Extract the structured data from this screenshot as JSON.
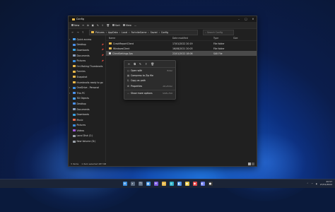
{
  "window": {
    "tab_title": "Config",
    "controls": [
      "–",
      "□",
      "✕"
    ]
  },
  "toolbar": {
    "new_label": "New",
    "sort_label": "Sort",
    "view_label": "View",
    "more_label": "..."
  },
  "address": {
    "path": [
      "Pictures",
      "AppData",
      "Local",
      "FortniteGame",
      "Saved",
      "Config"
    ],
    "search_placeholder": "Search Config"
  },
  "sidebar": {
    "items": [
      {
        "label": "Quick access",
        "icon": "star-icon",
        "color": "#4aa3ff",
        "top": true
      },
      {
        "label": "Desktop",
        "icon": "desktop-icon",
        "color": "#4a8fe8",
        "pinned": true
      },
      {
        "label": "Downloads",
        "icon": "download-icon",
        "color": "#3aa0e0",
        "pinned": true
      },
      {
        "label": "Documents",
        "icon": "documents-icon",
        "color": "#8aa0c0",
        "pinned": true
      },
      {
        "label": "Pictures",
        "icon": "pictures-icon",
        "color": "#3a8ee0",
        "pinned": true
      },
      {
        "label": "I'm Making Thumbnails",
        "icon": "folder-icon",
        "color": "#e8b84a"
      },
      {
        "label": "Funnies",
        "icon": "folder-icon",
        "color": "#e8b84a"
      },
      {
        "label": "Snapshot",
        "icon": "folder-icon",
        "color": "#e8b84a"
      },
      {
        "label": "thumbnails ready to go",
        "icon": "folder-icon",
        "color": "#e8b84a"
      },
      {
        "label": "OneDrive - Personal",
        "icon": "cloud-icon",
        "color": "#3a8ee0",
        "top": true
      },
      {
        "label": "This PC",
        "icon": "pc-icon",
        "color": "#4a8fe8",
        "top": true
      },
      {
        "label": "3D Objects",
        "icon": "cube-icon",
        "color": "#4aa3ff"
      },
      {
        "label": "Desktop",
        "icon": "desktop-icon",
        "color": "#4a8fe8"
      },
      {
        "label": "Documents",
        "icon": "documents-icon",
        "color": "#8aa0c0"
      },
      {
        "label": "Downloads",
        "icon": "download-icon",
        "color": "#3aa0e0"
      },
      {
        "label": "Music",
        "icon": "music-icon",
        "color": "#e86a4a"
      },
      {
        "label": "Pictures",
        "icon": "pictures-icon",
        "color": "#3a8ee0"
      },
      {
        "label": "Videos",
        "icon": "videos-icon",
        "color": "#a05ae0"
      },
      {
        "label": "Local Disk (C:)",
        "icon": "drive-icon",
        "color": "#9aa0a8"
      },
      {
        "label": "New Volume (D:)",
        "icon": "drive-icon",
        "color": "#9aa0a8"
      }
    ]
  },
  "columns": {
    "name": "Name",
    "date": "Date modified",
    "type": "Type",
    "size": "Size"
  },
  "files": [
    {
      "name": "CrashReportClient",
      "date": "17/01/2022 20:19",
      "type": "File folder",
      "size": "",
      "kind": "folder"
    },
    {
      "name": "WindowsClient",
      "date": "16/08/2021 20:03",
      "type": "File folder",
      "size": "",
      "kind": "folder"
    },
    {
      "name": "ClientSettings.Sav",
      "date": "22/01/2022 18:06",
      "type": "SAV File",
      "size": "",
      "kind": "file",
      "selected": true
    }
  ],
  "status": {
    "items": "3 items",
    "selected": "1 item selected  487 KB"
  },
  "context_menu": {
    "icons": [
      "cut-icon",
      "copy-icon",
      "rename-icon",
      "share-icon",
      "delete-icon"
    ],
    "icon_glyphs": [
      "✂",
      "⧉",
      "✎",
      "⇪",
      "🗑"
    ],
    "items": [
      {
        "label": "Open with",
        "shortcut": "Enter",
        "glyph": "▢"
      },
      {
        "label": "Compress to Zip file",
        "shortcut": "",
        "glyph": "▤"
      },
      {
        "label": "Copy as path",
        "shortcut": "",
        "glyph": "⎘"
      },
      {
        "label": "Properties",
        "shortcut": "Alt+Enter",
        "glyph": "⚙"
      },
      {
        "label": "Show more options",
        "shortcut": "Shift+F10",
        "glyph": "⋯",
        "separated": true
      }
    ]
  },
  "taskbar": {
    "apps": [
      {
        "name": "start-icon",
        "glyph": "⊞",
        "color": "#3a8ee0"
      },
      {
        "name": "search-icon",
        "glyph": "⌕",
        "color": "#5a6a80"
      },
      {
        "name": "task-view-icon",
        "glyph": "❐",
        "color": "#5a6a80"
      },
      {
        "name": "widgets-icon",
        "glyph": "▦",
        "color": "#3a8ee0"
      },
      {
        "name": "chat-icon",
        "glyph": "✉",
        "color": "#7a5ae0"
      },
      {
        "name": "file-explorer-icon",
        "glyph": "▭",
        "color": "#e8b84a"
      },
      {
        "name": "edge-icon",
        "glyph": "◎",
        "color": "#2ab0c8"
      },
      {
        "name": "store-icon",
        "glyph": "◧",
        "color": "#4a8fe8"
      },
      {
        "name": "chrome-icon",
        "glyph": "◉",
        "color": "#e8c84a"
      },
      {
        "name": "app-icon",
        "glyph": "◆",
        "color": "#e84a4a"
      },
      {
        "name": "discord-icon",
        "glyph": "◐",
        "color": "#6a7ae8"
      },
      {
        "name": "obs-icon",
        "glyph": "●",
        "color": "#3a3a3a"
      }
    ],
    "time": "20:57",
    "date": "27/01/2022"
  }
}
